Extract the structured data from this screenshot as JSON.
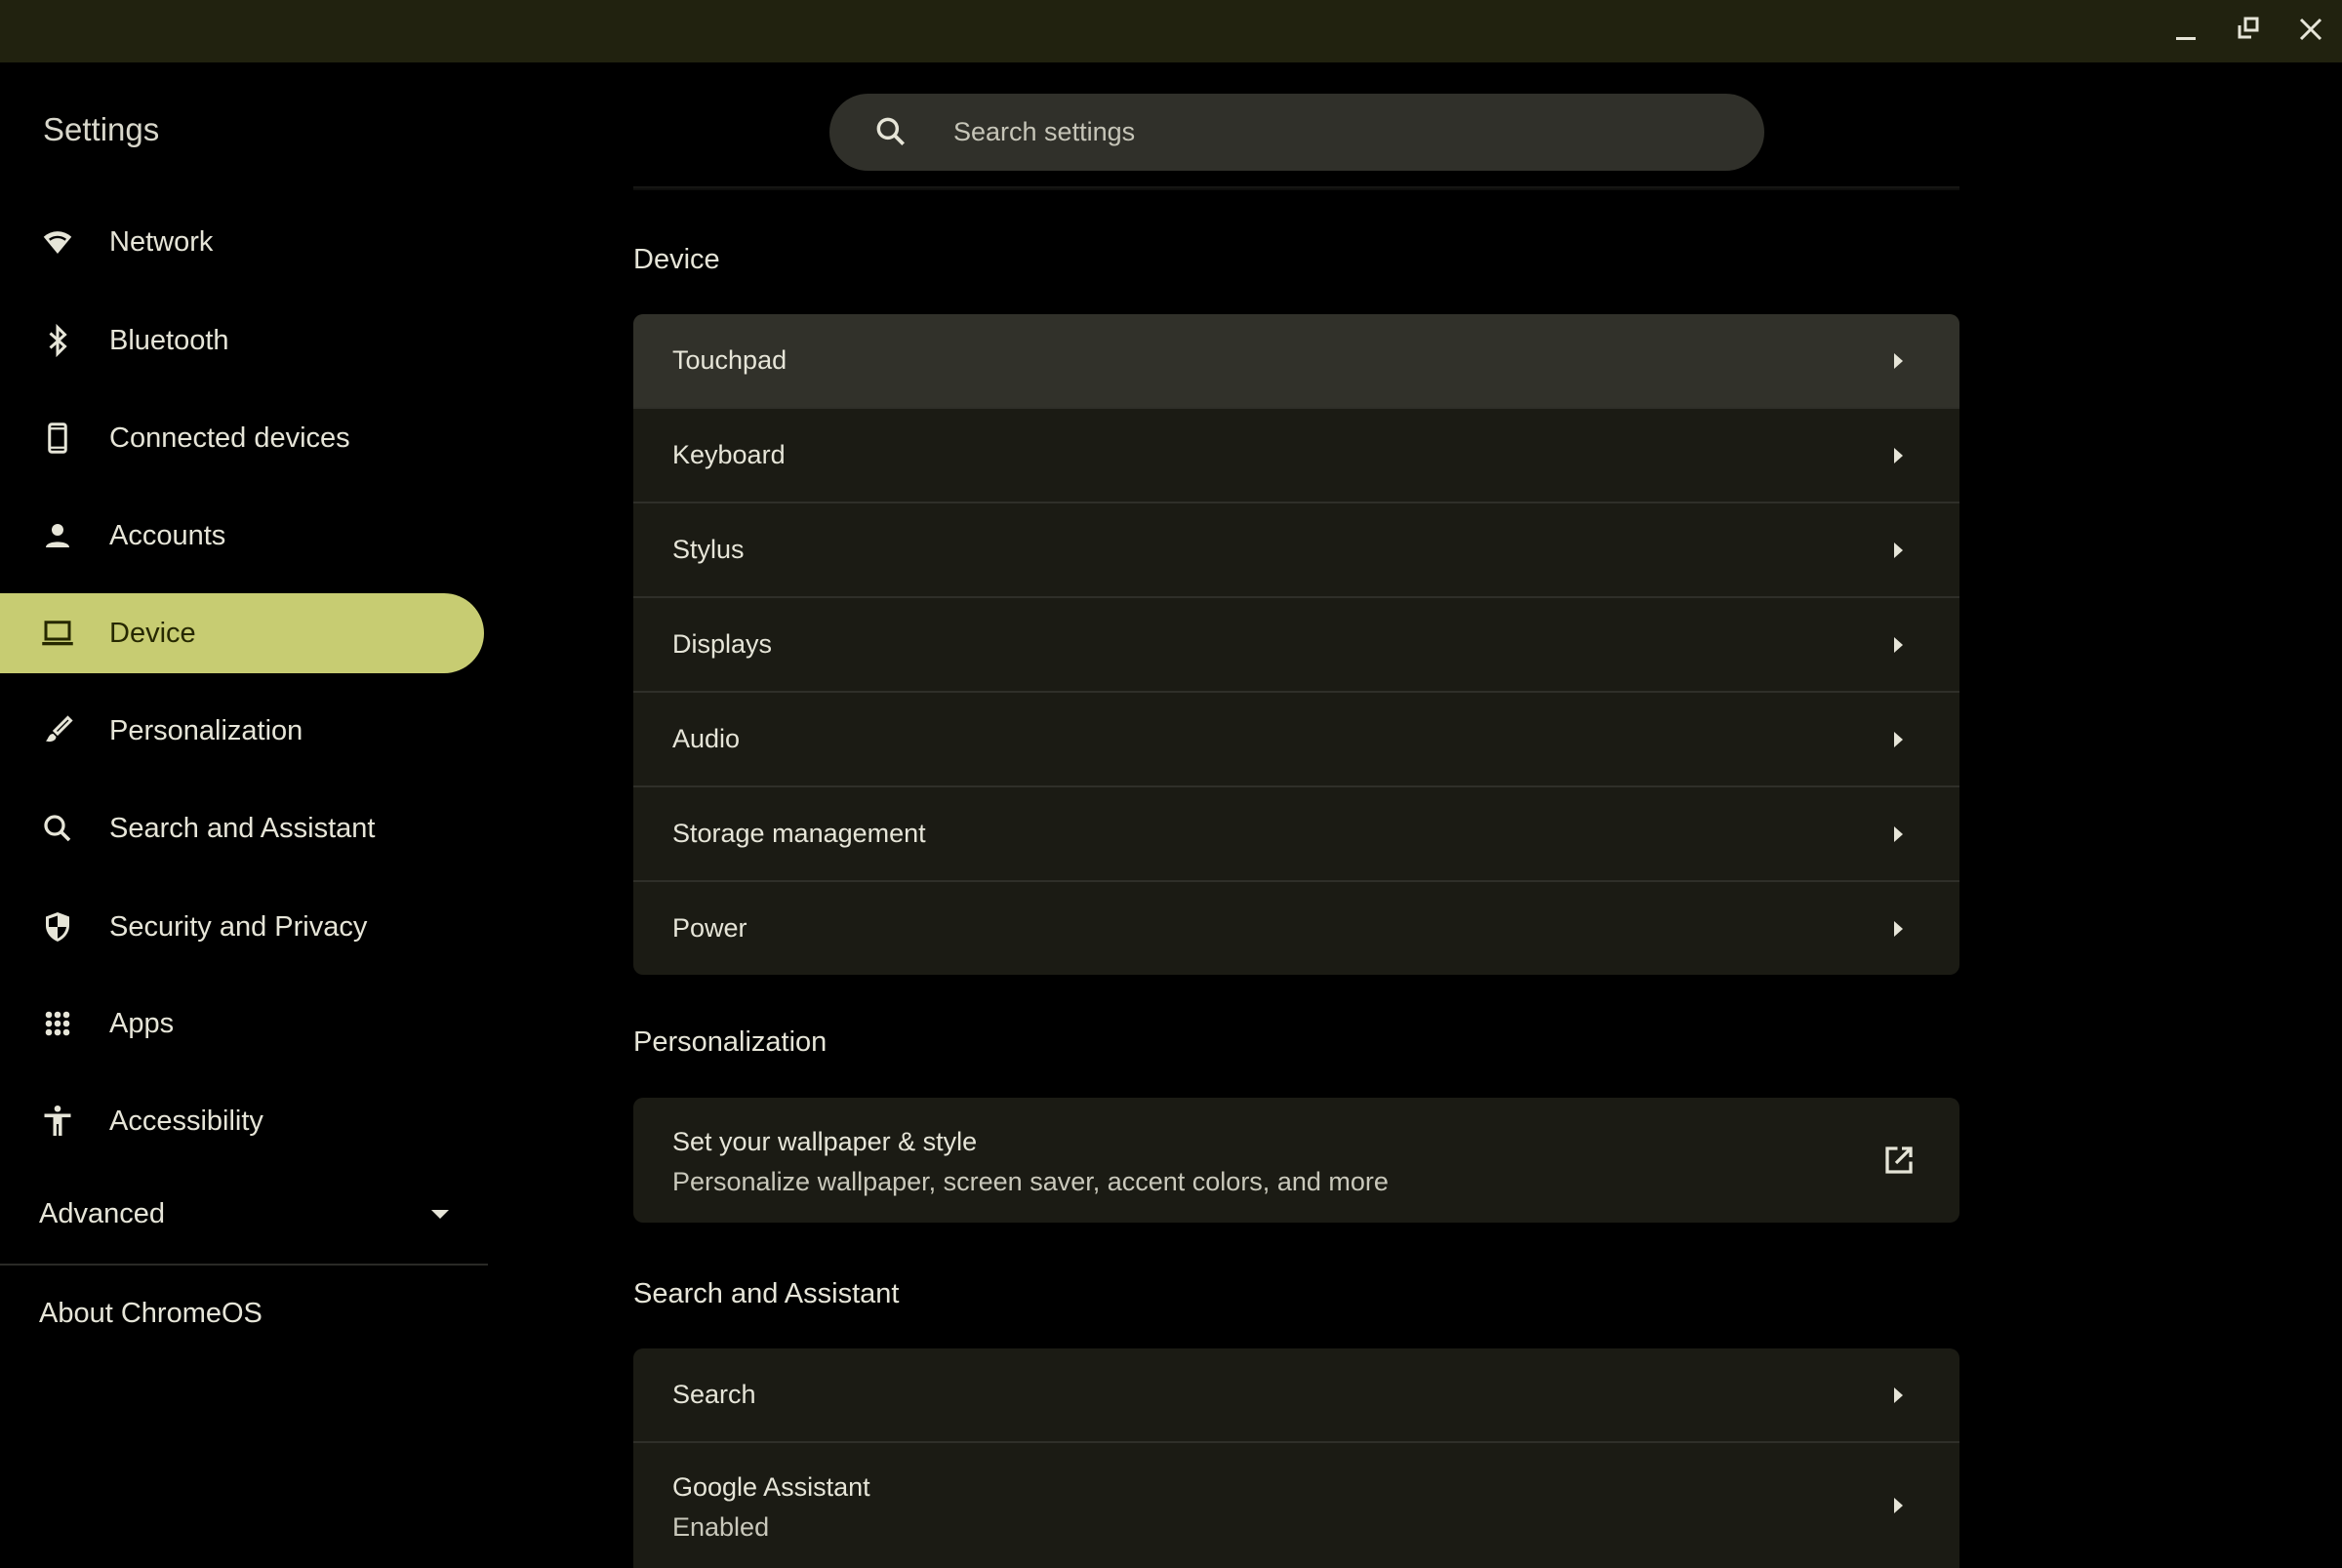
{
  "window": {
    "controls": {
      "minimize": "minimize-icon",
      "restore": "restore-icon",
      "close": "close-icon"
    },
    "title_bar_color": "#21220f"
  },
  "sidebar": {
    "title": "Settings",
    "items": [
      {
        "label": "Network",
        "icon": "wifi-icon"
      },
      {
        "label": "Bluetooth",
        "icon": "bluetooth-icon"
      },
      {
        "label": "Connected devices",
        "icon": "phone-icon"
      },
      {
        "label": "Accounts",
        "icon": "person-icon"
      },
      {
        "label": "Device",
        "icon": "laptop-icon",
        "active": true
      },
      {
        "label": "Personalization",
        "icon": "brush-icon"
      },
      {
        "label": "Search and Assistant",
        "icon": "search-icon"
      },
      {
        "label": "Security and Privacy",
        "icon": "shield-icon"
      },
      {
        "label": "Apps",
        "icon": "apps-grid-icon"
      },
      {
        "label": "Accessibility",
        "icon": "accessibility-icon"
      }
    ],
    "advanced": "Advanced",
    "about": "About ChromeOS",
    "active_color": "#c7cc72"
  },
  "search": {
    "placeholder": "Search settings"
  },
  "sections": {
    "device": {
      "title": "Device",
      "rows": [
        "Touchpad",
        "Keyboard",
        "Stylus",
        "Displays",
        "Audio",
        "Storage management",
        "Power"
      ]
    },
    "personalization": {
      "title": "Personalization",
      "row": {
        "title": "Set your wallpaper & style",
        "subtitle": "Personalize wallpaper, screen saver, accent colors, and more",
        "icon": "open-in-new-icon"
      }
    },
    "search_assistant": {
      "title": "Search and Assistant",
      "rows": [
        {
          "title": "Search"
        },
        {
          "title": "Google Assistant",
          "subtitle": "Enabled"
        }
      ]
    }
  }
}
